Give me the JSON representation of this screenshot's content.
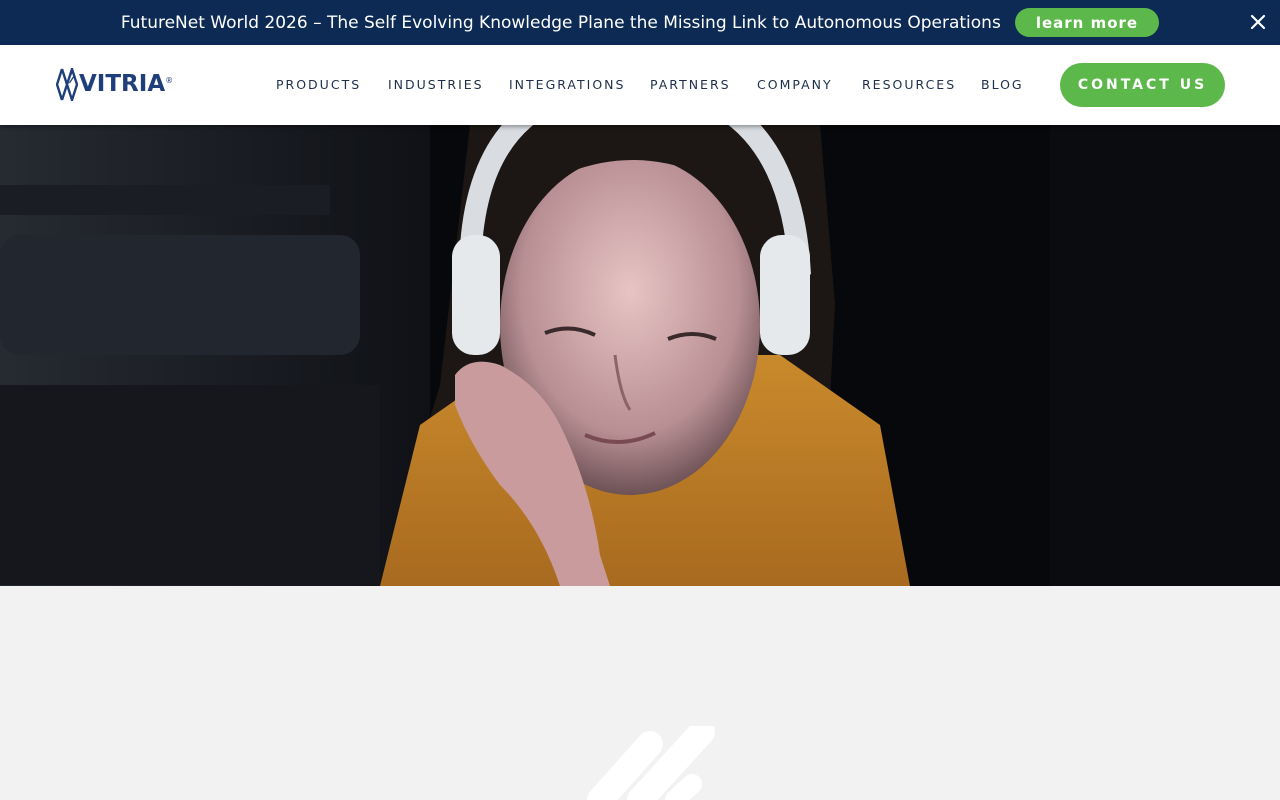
{
  "announcement": {
    "text": "FutureNet World 2026 – The Self Evolving Knowledge Plane the Missing Link to Autonomous Operations",
    "button_label": "learn more",
    "close_icon": "close-icon"
  },
  "header": {
    "logo_text": "VITRIA",
    "logo_reg": "®",
    "nav": [
      {
        "label": "PRODUCTS"
      },
      {
        "label": "INDUSTRIES"
      },
      {
        "label": "INTEGRATIONS"
      },
      {
        "label": "PARTNERS"
      },
      {
        "label": "COMPANY"
      },
      {
        "label": "RESOURCES"
      },
      {
        "label": "BLOG"
      }
    ],
    "contact_label": "CONTACT US"
  },
  "hero": {
    "image_subject": "woman with white headphones looking at a screen in a dark room"
  },
  "colors": {
    "announcement_bg": "#0d2a55",
    "accent_green": "#5db84b",
    "brand_blue": "#1f3f7a",
    "section_bg": "#f2f2f2"
  }
}
